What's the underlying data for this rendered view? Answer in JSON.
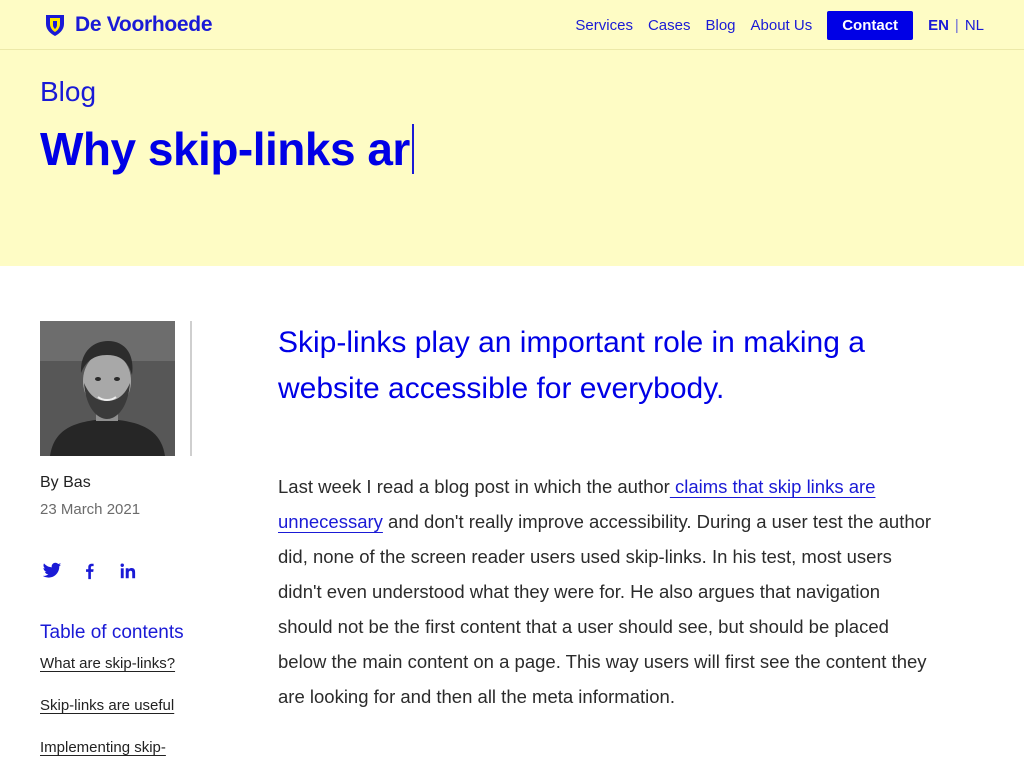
{
  "brand": {
    "name": "De Voorhoede",
    "colors": {
      "primary": "#0000e6",
      "link": "#1a1ad6",
      "hero_bg": "#fefcc5"
    }
  },
  "nav": {
    "items": [
      "Services",
      "Cases",
      "Blog",
      "About Us"
    ],
    "contact_label": "Contact",
    "languages": [
      {
        "code": "EN",
        "active": true
      },
      {
        "code": "NL",
        "active": false
      }
    ],
    "separator": "|"
  },
  "hero": {
    "kicker": "Blog",
    "title": "Why skip-links ar"
  },
  "author": {
    "byline": "By Bas",
    "date": "23 March 2021",
    "social": [
      "twitter-icon",
      "facebook-icon",
      "linkedin-icon"
    ]
  },
  "toc": {
    "title": "Table of contents",
    "items": [
      "What are skip-links?",
      "Skip-links are useful",
      "Implementing skip-"
    ]
  },
  "article": {
    "lead": "Skip-links play an important role in making a website accessible for everybody.",
    "para1_before": "Last week I read a blog post in which the author",
    "para1_link": " claims that skip links are unnecessary",
    "para1_after": " and don't really improve accessibility. During a user test the author did, none of the screen reader users used skip-links. In his test, most users didn't even understood what they were for. He also argues that navigation should not be the first content that a user should see, but should be placed below the main content on a page. This way users will first see the content they are looking for and then all the meta information."
  }
}
